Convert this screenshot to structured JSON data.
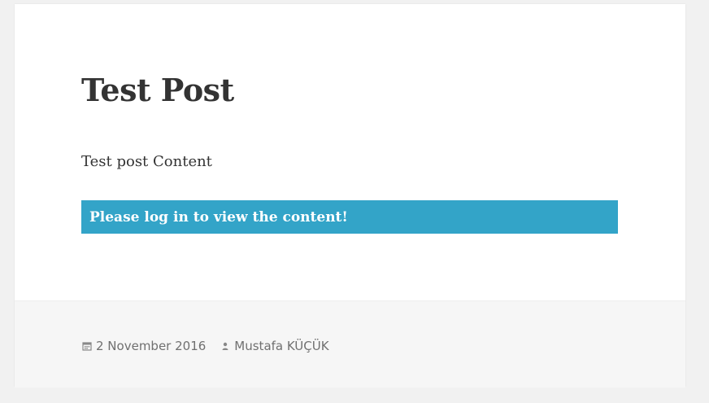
{
  "post": {
    "title": "Test Post",
    "content": "Test post Content",
    "login_notice": "Please log in to view the content!"
  },
  "footer": {
    "date": "2 November 2016",
    "author": "Mustafa KÜÇÜK",
    "date_icon": "calendar-icon",
    "author_icon": "user-icon"
  },
  "colors": {
    "notice_background": "#33a4c8",
    "notice_text": "#ffffff",
    "title_text": "#333333",
    "footer_background": "#f6f6f6",
    "footer_text": "#707070",
    "page_background": "#f1f1f1"
  }
}
